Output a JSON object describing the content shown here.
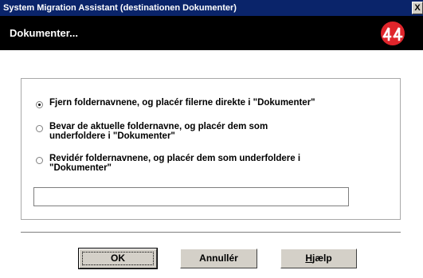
{
  "window": {
    "title": "System Migration Assistant (destinationen Dokumenter)",
    "close_label": "X"
  },
  "header": {
    "title": "Dokumenter...",
    "logo_icon": "sma-logo-icon"
  },
  "options": [
    {
      "label": "Fjern foldernavnene, og placér filerne direkte i \"Dokumenter\"",
      "selected": true
    },
    {
      "label": "Bevar de aktuelle foldernavne, og placér dem som underfoldere i \"Dokumenter\"",
      "selected": false
    },
    {
      "label": "Revidér foldernavnene, og placér dem som underfoldere i \"Dokumenter\"",
      "selected": false
    }
  ],
  "folder_name_input": {
    "value": ""
  },
  "buttons": {
    "ok": "OK",
    "cancel": "Annullér",
    "help_mnemonic": "H",
    "help_rest": "jælp"
  },
  "colors": {
    "titlebar": "#0a246a",
    "header": "#000000",
    "logo_red": "#e0252b"
  }
}
